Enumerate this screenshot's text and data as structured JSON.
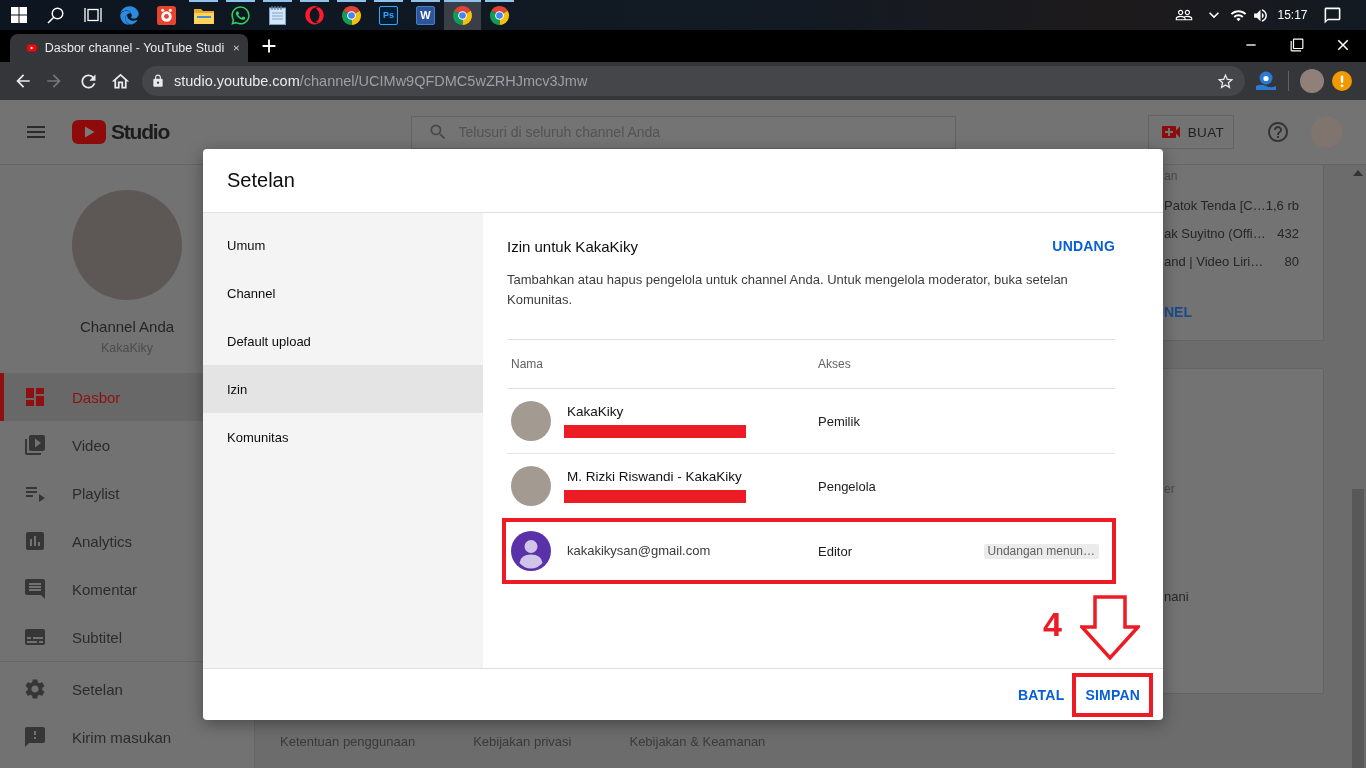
{
  "taskbar": {
    "apps": [
      {
        "running": false,
        "selected": false
      },
      {
        "running": false,
        "selected": false
      },
      {
        "running": true,
        "selected": false
      },
      {
        "running": true,
        "selected": false
      },
      {
        "running": true,
        "selected": false
      },
      {
        "running": true,
        "selected": false
      },
      {
        "running": true,
        "selected": false
      },
      {
        "glyph": "Ps",
        "running": true,
        "selected": false
      },
      {
        "glyph": "W",
        "running": true,
        "selected": false
      },
      {
        "running": true,
        "selected": true
      },
      {
        "running": true,
        "selected": false
      }
    ],
    "clock": "15:17"
  },
  "browser": {
    "tab_title": "Dasbor channel - YouTube Studi",
    "forward_disabled": true,
    "address": {
      "host": "studio.youtube.com",
      "path": "/channel/UCIMw9QFDMC5wZRHJmcv3Jmw"
    }
  },
  "studio_header": {
    "logo_text": "Studio",
    "search_placeholder": "Telusuri di seluruh channel Anda",
    "create_button": "BUAT"
  },
  "sidebar": {
    "channel_title": "Channel Anda",
    "channel_name": "KakaKiky",
    "items": [
      {
        "label": "Dasbor",
        "selected": true
      },
      {
        "label": "Video",
        "selected": false
      },
      {
        "label": "Playlist",
        "selected": false
      },
      {
        "label": "Analytics",
        "selected": false
      },
      {
        "label": "Komentar",
        "selected": false
      },
      {
        "label": "Subtitel",
        "selected": false
      }
    ],
    "bottom_items": [
      {
        "label": "Setelan",
        "selected": false
      },
      {
        "label": "Kirim masukan",
        "selected": false
      }
    ]
  },
  "background_cards": [
    {
      "heading": "an",
      "rows": [
        {
          "title": "Patok Tenda [C…",
          "views": "1,6 rb"
        },
        {
          "title": "ak Suyitno (Offi…",
          "views": "432"
        },
        {
          "title": "and | Video Liri…",
          "views": "80"
        }
      ],
      "link": "NEL"
    },
    {
      "lines": [
        {
          "kind": "label",
          "text": "er"
        },
        {
          "kind": "text",
          "text": "nani"
        }
      ]
    }
  ],
  "footer_links": [
    "Ketentuan penggunaan",
    "Kebijakan privasi",
    "Kebijakan & Keamanan"
  ],
  "dialog": {
    "title": "Setelan",
    "nav": [
      {
        "label": "Umum",
        "selected": false
      },
      {
        "label": "Channel",
        "selected": false
      },
      {
        "label": "Default upload",
        "selected": false
      },
      {
        "label": "Izin",
        "selected": true
      },
      {
        "label": "Komunitas",
        "selected": false
      }
    ],
    "section": {
      "title": "Izin untuk KakaKiky",
      "action": "UNDANG",
      "description": "Tambahkan atau hapus pengelola untuk channel Anda. Untuk mengelola moderator, buka setelan Komunitas.",
      "columns": [
        "Nama",
        "Akses"
      ],
      "members": [
        {
          "kind": "member",
          "name": "KakaKiky",
          "email_hidden": true,
          "access": "Pemilik",
          "highlighted": false
        },
        {
          "kind": "member",
          "name": "M. Rizki Riswandi - KakaKiky",
          "email_hidden": true,
          "access": "Pengelola",
          "highlighted": false
        },
        {
          "kind": "invite",
          "email": "kakakikysan@gmail.com",
          "email_hidden": false,
          "access": "Editor",
          "status": "Undangan menun…",
          "highlighted": true
        }
      ]
    },
    "buttons": [
      {
        "label": "BATAL",
        "highlighted": false
      },
      {
        "label": "SIMPAN",
        "highlighted": true
      }
    ]
  },
  "annotation": {
    "step": "4"
  }
}
